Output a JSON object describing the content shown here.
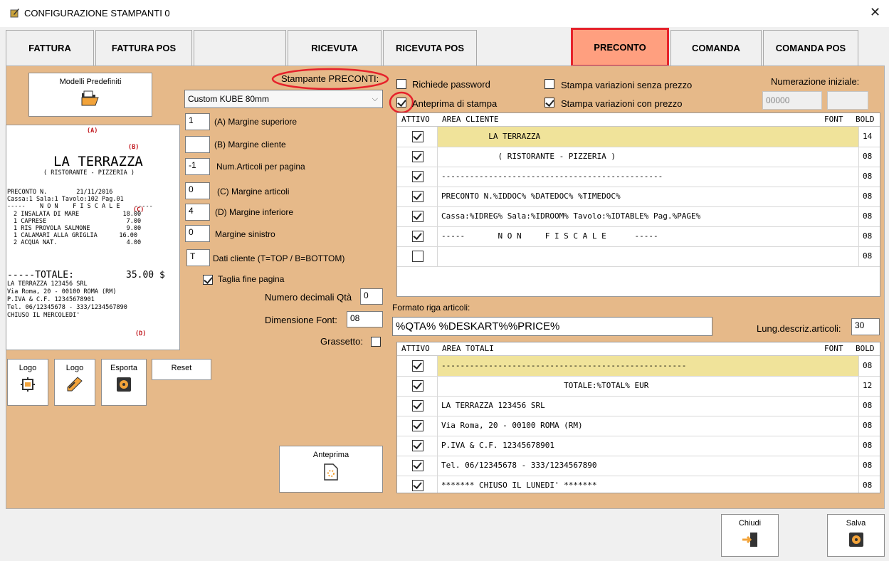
{
  "window": {
    "title": "CONFIGURAZIONE STAMPANTI 0",
    "close_glyph": "✕"
  },
  "tabs": [
    {
      "label": "FATTURA"
    },
    {
      "label": "FATTURA POS"
    },
    {
      "label": ""
    },
    {
      "label": "RICEVUTA"
    },
    {
      "label": "RICEVUTA POS"
    },
    {
      "label": "PRECONTO",
      "active": true
    },
    {
      "label": "COMANDA"
    },
    {
      "label": "COMANDA POS"
    }
  ],
  "left": {
    "modelli_label": "Modelli Predefiniti",
    "buttons": {
      "logo1": "Logo",
      "logo2": "Logo",
      "esporta": "Esporta",
      "reset": "Reset",
      "anteprima": "Anteprima"
    },
    "receipt": {
      "marker_a": "(A)",
      "marker_b": "(B)",
      "marker_c": "(C)",
      "marker_d": "(D)",
      "title": "LA TERRAZZA",
      "subtitle": "( RISTORANTE - PIZZERIA )",
      "line_preconto": "PRECONTO N.        21/11/2016",
      "line_cassa": "Cassa:1 Sala:1 Tavolo:102 Pag.01",
      "line_nonfiscale": "-----    N O N    F I S C A L E    -----",
      "items": [
        "2 INSALATA DI MARE            18.00",
        "1 CAPRESE                      7.00",
        "1 RIS PROVOLA SALMONE          9.00",
        "1 CALAMARI ALLA GRIGLIA      16.00",
        "2 ACQUA NAT.                   4.00"
      ],
      "total_label": "-----TOTALE:",
      "total_value": "35.00 $",
      "footer": [
        "LA TERRAZZA 123456 SRL",
        "Via Roma, 20 - 00100 ROMA (RM)",
        "P.IVA & C.F. 12345678901",
        "Tel. 06/12345678 - 333/1234567890",
        "CHIUSO IL MERCOLEDI'"
      ]
    }
  },
  "middle": {
    "stampante_label": "Stampante PRECONTI:",
    "printer_selected": "Custom KUBE 80mm",
    "fields": [
      {
        "value": "1",
        "label": "(A) Margine superiore"
      },
      {
        "value": "",
        "label": "(B) Margine cliente"
      },
      {
        "value": "-1",
        "label": "Num.Articoli per pagina"
      },
      {
        "value": "0",
        "label": "(C) Margine articoli"
      },
      {
        "value": "4",
        "label": "(D) Margine inferiore"
      },
      {
        "value": "0",
        "label": "Margine sinistro"
      },
      {
        "value": "T",
        "label": "Dati cliente (T=TOP / B=BOTTOM)"
      }
    ],
    "taglia_label": "Taglia fine pagina",
    "decimali_label": "Numero decimali Qtà",
    "decimali_value": "0",
    "font_label": "Dimensione Font:",
    "font_value": "08",
    "grassetto_label": "Grassetto:"
  },
  "right": {
    "richiede_password": "Richiede password",
    "anteprima_stampa": "Anteprima di stampa",
    "stampa_senza_prezzo": "Stampa variazioni senza prezzo",
    "stampa_con_prezzo": "Stampa variazioni con prezzo",
    "numerazione_label": "Numerazione iniziale:",
    "numerazione_value": "00000",
    "cliente_headers": {
      "attivo": "ATTIVO",
      "area": "AREA CLIENTE",
      "font": "FONT",
      "bold": "BOLD"
    },
    "cliente_rows": [
      {
        "attivo": true,
        "text": "          LA TERRAZZA",
        "font": "14",
        "bold": false
      },
      {
        "attivo": true,
        "text": "            ( RISTORANTE - PIZZERIA )",
        "font": "08",
        "bold": false
      },
      {
        "attivo": true,
        "text": "-----------------------------------------------",
        "font": "08",
        "bold": false
      },
      {
        "attivo": true,
        "text": "PRECONTO N.%IDDOC% %DATEDOC% %TIMEDOC%",
        "font": "08",
        "bold": false
      },
      {
        "attivo": true,
        "text": "Cassa:%IDREG% Sala:%IDROOM% Tavolo:%IDTABLE% Pag.%PAGE%",
        "font": "08",
        "bold": false
      },
      {
        "attivo": true,
        "text": "-----       N O N     F I S C A L E      -----",
        "font": "08",
        "bold": false
      },
      {
        "attivo": false,
        "text": "",
        "font": "08",
        "bold": false
      }
    ],
    "formato_label": "Formato riga articoli:",
    "formato_value": "%QTA% %DESKART%%PRICE%",
    "lung_label": "Lung.descriz.articoli:",
    "lung_value": "30",
    "totali_headers": {
      "attivo": "ATTIVO",
      "area": "AREA TOTALI",
      "font": "FONT",
      "bold": "BOLD"
    },
    "totali_rows": [
      {
        "attivo": true,
        "text": "----------------------------------------------------",
        "font": "08",
        "bold": false
      },
      {
        "attivo": true,
        "text": "                          TOTALE:%TOTAL% EUR",
        "font": "12",
        "bold": true
      },
      {
        "attivo": true,
        "text": "LA TERRAZZA 123456 SRL",
        "font": "08",
        "bold": false
      },
      {
        "attivo": true,
        "text": "Via Roma, 20 - 00100 ROMA (RM)",
        "font": "08",
        "bold": false
      },
      {
        "attivo": true,
        "text": "P.IVA & C.F. 12345678901",
        "font": "08",
        "bold": false
      },
      {
        "attivo": true,
        "text": "Tel. 06/12345678 - 333/1234567890",
        "font": "08",
        "bold": false
      },
      {
        "attivo": true,
        "text": "******* CHIUSO IL LUNEDI' *******",
        "font": "08",
        "bold": false
      }
    ]
  },
  "footer": {
    "chiudi": "Chiudi",
    "salva": "Salva"
  },
  "colors": {
    "panel": "#e6b989",
    "active_tab": "#ff9f7f",
    "highlight": "#e6222b",
    "row_highlight": "#f0e39a"
  }
}
